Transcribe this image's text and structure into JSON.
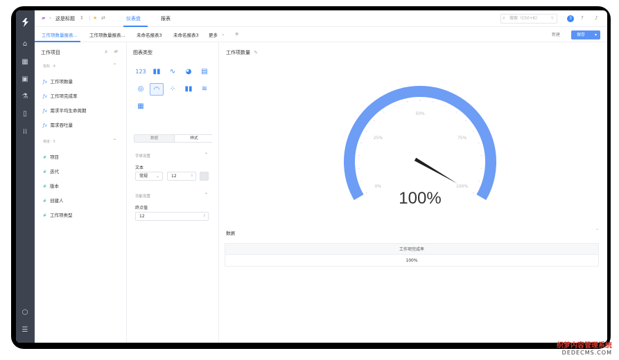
{
  "topbar": {
    "title": "这是标题",
    "tabs": [
      {
        "label": "仪表盘",
        "active": true
      },
      {
        "label": "报表",
        "active": false
      }
    ],
    "search_placeholder": "搜索（Ctrl+K）",
    "avatar_initial": "3"
  },
  "report_tabs": {
    "items": [
      {
        "label": "工作项数量报表...",
        "active": true
      },
      {
        "label": "工作项数量报表..."
      },
      {
        "label": "未命名报表3"
      },
      {
        "label": "未命名报表3"
      }
    ],
    "more_label": "更多",
    "new_label": "新建",
    "save_label": "保存"
  },
  "fields_panel": {
    "title": "工作项目",
    "measures_group": "指标 · 4",
    "measures": [
      "工作项数量",
      "工作项完成率",
      "需求平均生命周期",
      "需求吞吐量"
    ],
    "dimensions_group": "维度 · 5",
    "dimensions": [
      "项目",
      "迭代",
      "版本",
      "创建人",
      "工作项类型"
    ]
  },
  "chart_panel": {
    "title": "图表类型",
    "seg_data": "数据",
    "seg_style": "样式",
    "section_font": "字体设置",
    "text_label": "文本",
    "font_weight": "常规",
    "font_size": "12",
    "section_func": "功能设置",
    "end_label": "终点值",
    "end_value": "12"
  },
  "main": {
    "chart_title": "工作项数量",
    "data_header": "数据",
    "table_header": "工作项完成率",
    "table_value": "100%"
  },
  "chart_data": {
    "type": "gauge",
    "value": 100,
    "value_label": "100%",
    "min": 0,
    "max": 100,
    "tick_labels": [
      "0%",
      "25%",
      "50%",
      "75%",
      "100%"
    ],
    "color": "#6d9df5"
  },
  "watermark": {
    "line1": "织梦内容管理系统",
    "line2": "DEDECMS.COM"
  }
}
